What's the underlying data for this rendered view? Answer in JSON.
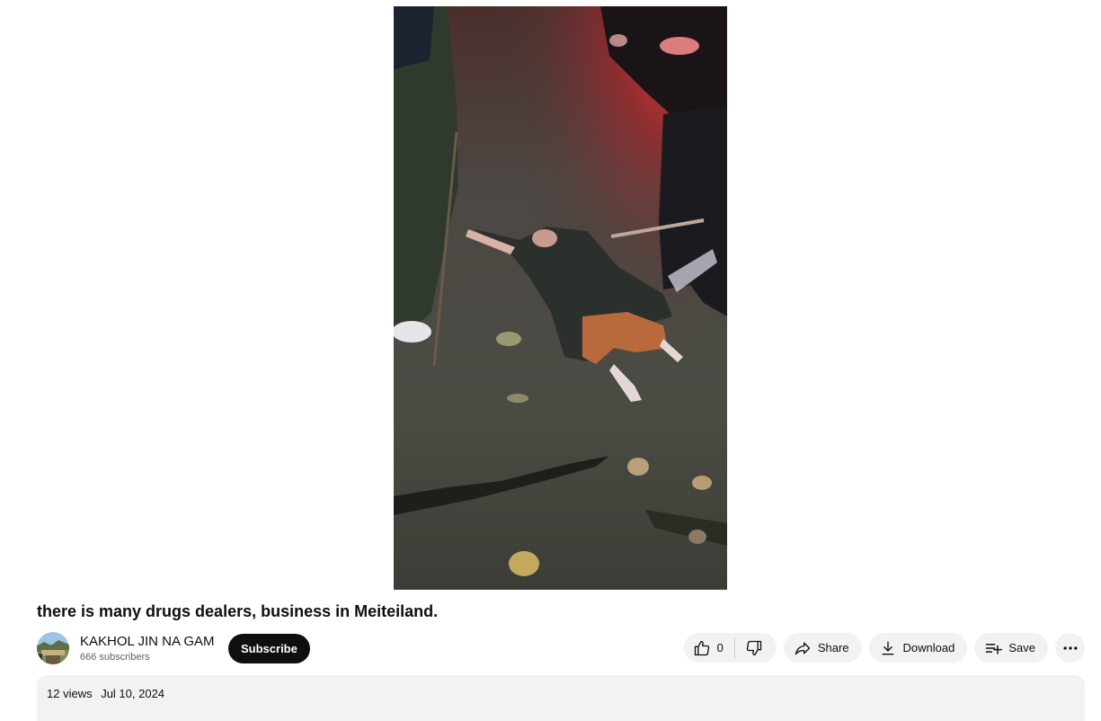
{
  "video": {
    "title": "there is many drugs dealers, business in Meiteiland."
  },
  "channel": {
    "name": "KAKHOL JIN NA GAM",
    "subscribers": "666 subscribers",
    "subscribe_label": "Subscribe",
    "avatar_icon": "channel-avatar-landscape"
  },
  "actions": {
    "like_count": "0",
    "like_icon": "thumbs-up-icon",
    "dislike_icon": "thumbs-down-icon",
    "share_label": "Share",
    "share_icon": "share-arrow-icon",
    "download_label": "Download",
    "download_icon": "download-icon",
    "save_label": "Save",
    "save_icon": "playlist-add-icon",
    "more_icon": "more-horizontal-icon"
  },
  "description": {
    "views": "12 views",
    "date": "Jul 10, 2024"
  },
  "colors": {
    "subscribe_bg": "#0f0f0f",
    "pill_bg": "#f2f2f2",
    "secondary_text": "#606060"
  }
}
